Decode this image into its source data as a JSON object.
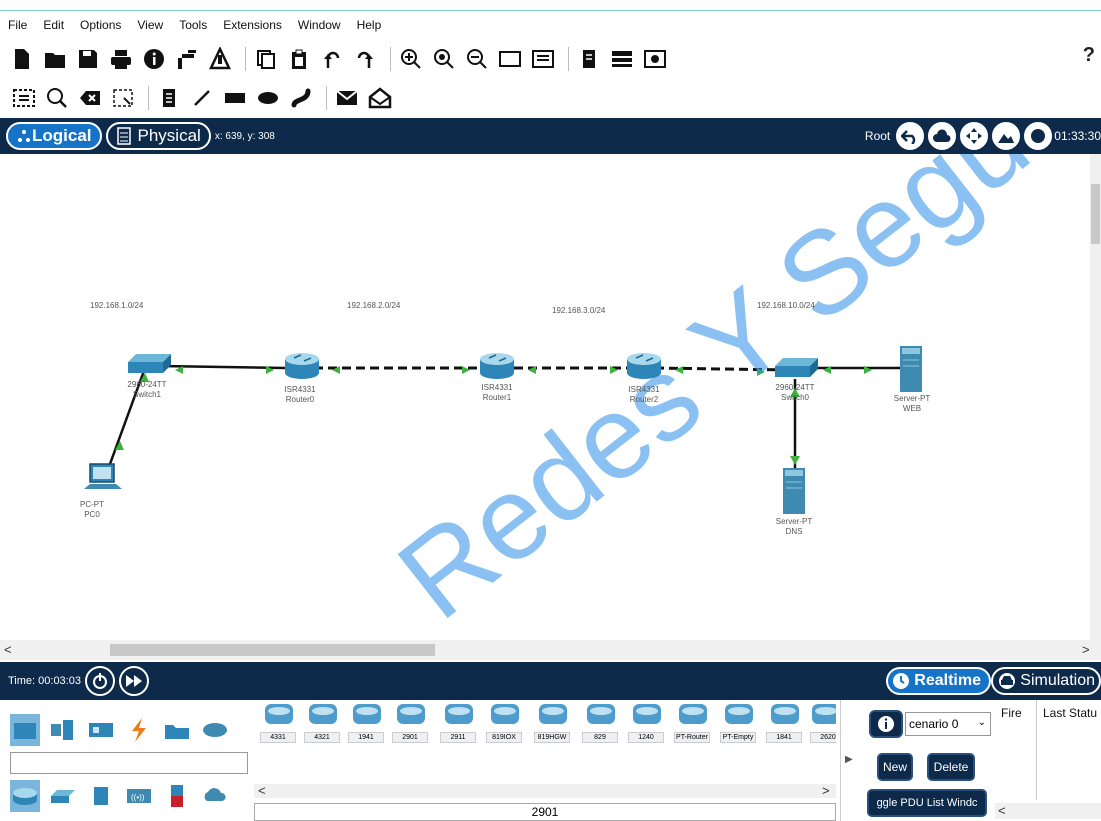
{
  "menu": [
    "File",
    "Edit",
    "Options",
    "View",
    "Tools",
    "Extensions",
    "Window",
    "Help"
  ],
  "help_label": "?",
  "modebar": {
    "logical": "Logical",
    "physical": "Physical",
    "coords": "x: 639, y: 308",
    "root": "Root",
    "clock": "01:33:30"
  },
  "networks": [
    "192.168.1.0/24",
    "192.168.2.0/24",
    "192.168.3.0/24",
    "192.168.10.0/24"
  ],
  "devices": {
    "switch1": [
      "2960-24TT",
      "Switch1"
    ],
    "router0": [
      "ISR4331",
      "Router0"
    ],
    "router1": [
      "ISR4331",
      "Router1"
    ],
    "router2": [
      "ISR4331",
      "Router2"
    ],
    "switch0": [
      "2960-24TT",
      "Switch0"
    ],
    "server_web": [
      "Server-PT",
      "WEB"
    ],
    "server_dns": [
      "Server-PT",
      "DNS"
    ],
    "pc0": [
      "PC-PT",
      "PC0"
    ]
  },
  "bottom": {
    "time": "Time: 00:03:03",
    "realtime": "Realtime",
    "simulation": "Simulation"
  },
  "models": [
    "4331",
    "4321",
    "1941",
    "2901",
    "2911",
    "819IOX",
    "819HGW",
    "829",
    "1240",
    "PT-Router",
    "PT-Empty",
    "1841",
    "2620"
  ],
  "model_caption": "2901",
  "pdu": {
    "scenario": "cenario 0",
    "new": "New",
    "delete": "Delete",
    "toggle": "ggle PDU List Windc",
    "col_fire": "Fire",
    "col_status": "Last Statu"
  },
  "watermark": "Redes Y Seguridad"
}
